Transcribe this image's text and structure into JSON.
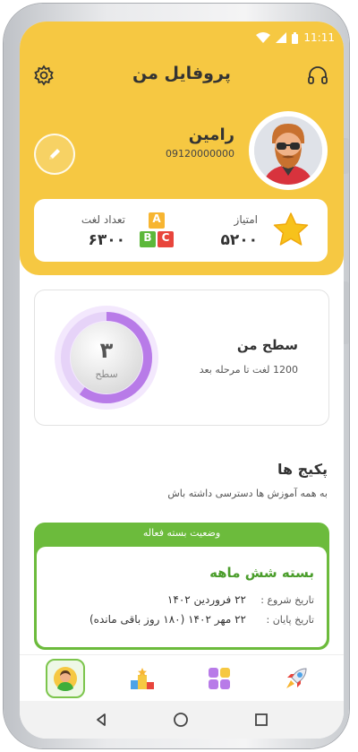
{
  "status_bar": {
    "time": "11:11"
  },
  "header": {
    "title": "پروفایل من"
  },
  "user": {
    "name": "رامین",
    "phone": "09120000000"
  },
  "stats": {
    "score_label": "امتیاز",
    "score_value": "۵۲۰۰",
    "words_label": "تعداد لغت",
    "words_value": "۶۳۰۰",
    "abc_letters": [
      "A",
      "B",
      "C"
    ]
  },
  "level": {
    "title": "سطح من",
    "subtitle": "1200 لغت تا مرحله بعد",
    "number": "۳",
    "label": "سطح",
    "progress": 0.6
  },
  "packages": {
    "title": "پکیج ها",
    "subtitle": "به همه آموزش ها دسترسی داشته باش",
    "active_header": "وضعیت بسته فعاله",
    "plan_name": "بسته شش ماهه",
    "start_label": "تاریخ شروع :",
    "start_value": "۲۲ فروردین ۱۴۰۲",
    "end_label": "تاریخ پایان :",
    "end_value": "۲۲ مهر ۱۴۰۲ (۱۸۰ روز باقی مانده)"
  },
  "colors": {
    "header_bg": "#f6c842",
    "accent_green": "#6cbb3c",
    "ring_purple": "#b87be8"
  },
  "icons": {
    "settings": "gear-icon",
    "support": "headset-icon",
    "edit": "pencil-icon",
    "score": "star-icon",
    "nav": [
      "profile-icon",
      "leaderboard-icon",
      "categories-icon",
      "rocket-icon"
    ]
  }
}
